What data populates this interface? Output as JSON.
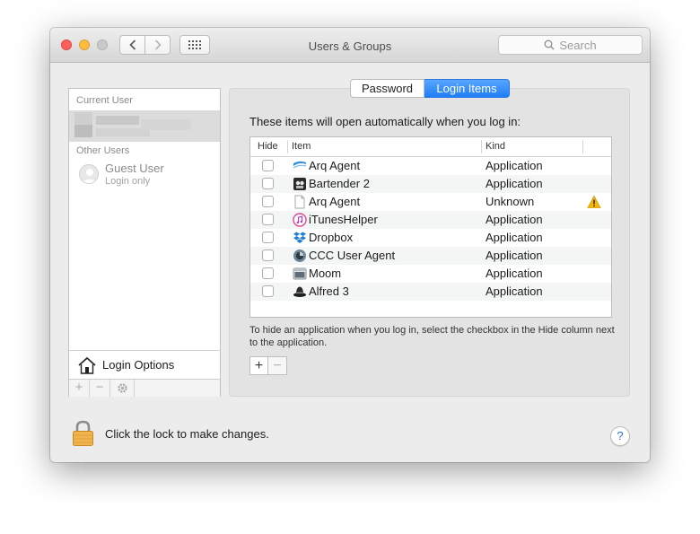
{
  "window": {
    "title": "Users & Groups",
    "search_placeholder": "Search"
  },
  "sidebar": {
    "current_user_label": "Current User",
    "other_users_label": "Other Users",
    "guest": {
      "name": "Guest User",
      "subtitle": "Login only"
    },
    "login_options_label": "Login Options"
  },
  "tabs": [
    {
      "label": "Password",
      "selected": false
    },
    {
      "label": "Login Items",
      "selected": true
    }
  ],
  "panel": {
    "intro": "These items will open automatically when you log in:",
    "columns": {
      "hide": "Hide",
      "item": "Item",
      "kind": "Kind"
    },
    "items": [
      {
        "name": "Arq Agent",
        "kind": "Application",
        "icon": "arq-agent-icon",
        "hidden": false,
        "warning": false
      },
      {
        "name": "Bartender 2",
        "kind": "Application",
        "icon": "bartender-icon",
        "hidden": false,
        "warning": false
      },
      {
        "name": "Arq Agent",
        "kind": "Unknown",
        "icon": "blank-document-icon",
        "hidden": false,
        "warning": true
      },
      {
        "name": "iTunesHelper",
        "kind": "Application",
        "icon": "itunes-icon",
        "hidden": false,
        "warning": false
      },
      {
        "name": "Dropbox",
        "kind": "Application",
        "icon": "dropbox-icon",
        "hidden": false,
        "warning": false
      },
      {
        "name": "CCC User Agent",
        "kind": "Application",
        "icon": "ccc-icon",
        "hidden": false,
        "warning": false
      },
      {
        "name": "Moom",
        "kind": "Application",
        "icon": "moom-icon",
        "hidden": false,
        "warning": false
      },
      {
        "name": "Alfred 3",
        "kind": "Application",
        "icon": "alfred-icon",
        "hidden": false,
        "warning": false
      }
    ],
    "help_text": "To hide an application when you log in, select the checkbox in the Hide column next to the application.",
    "add_label": "+",
    "remove_label": "−"
  },
  "footer": {
    "lock_text": "Click the lock to make changes.",
    "help_label": "?"
  },
  "colors": {
    "accent": "#1f7df5",
    "close": "#fc605c",
    "minimize": "#fdbc40",
    "warning": "#f5b800",
    "lock": "#e8a33c"
  }
}
